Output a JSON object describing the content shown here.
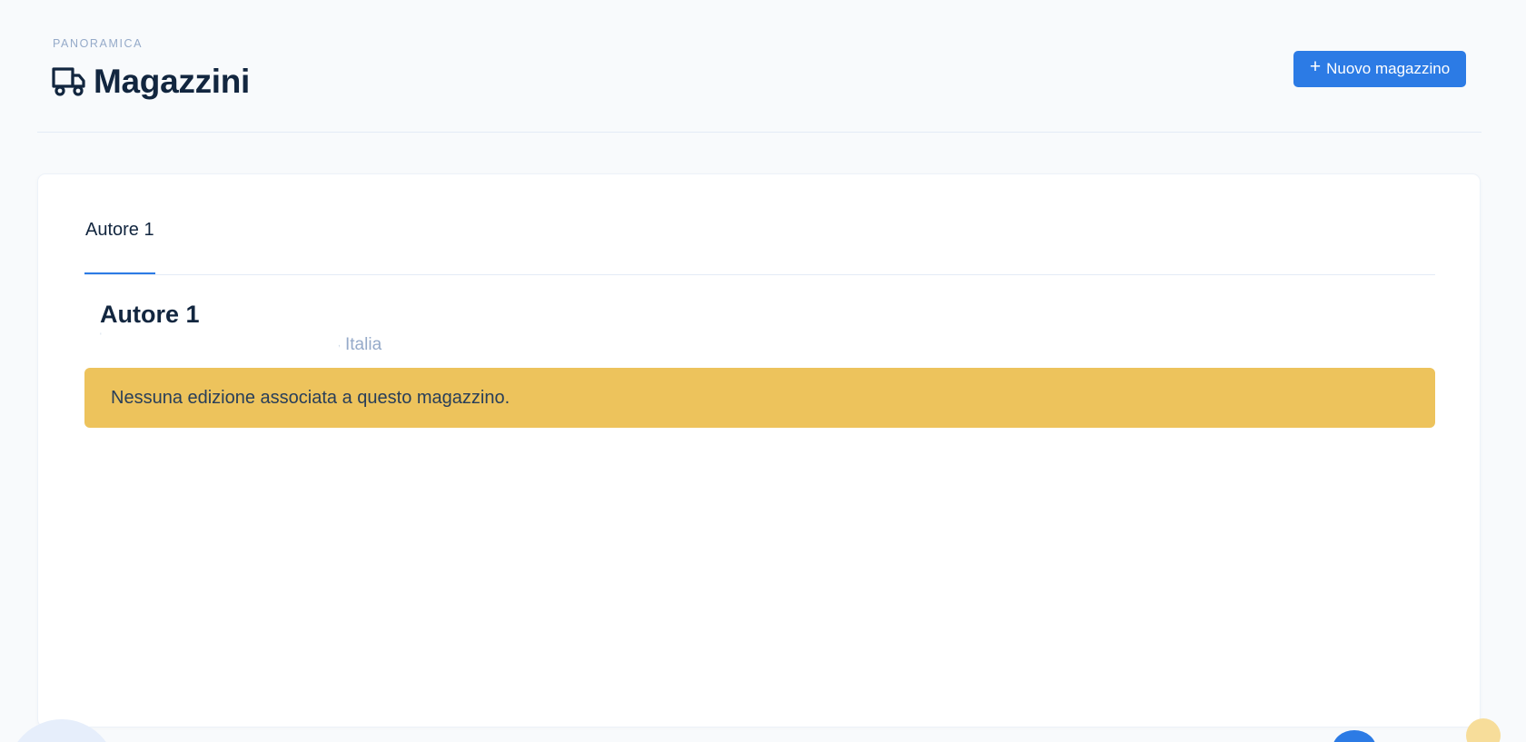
{
  "header": {
    "pretitle": "PANORAMICA",
    "title": "Magazzini",
    "title_icon": "truck-icon",
    "new_button_icon": "plus-icon",
    "new_button_label": "Nuovo magazzino"
  },
  "tabs": [
    {
      "label": "Autore 1",
      "active": true
    }
  ],
  "warehouse": {
    "name": "Autore 1",
    "address_country": "Italia"
  },
  "alert": {
    "message": "Nessuna edizione associata a questo magazzino."
  },
  "colors": {
    "accent": "#2c7be5",
    "warning": "#edc35c",
    "background": "#f8fafc",
    "text_dark": "#12263f",
    "text_muted": "#95aac9"
  }
}
